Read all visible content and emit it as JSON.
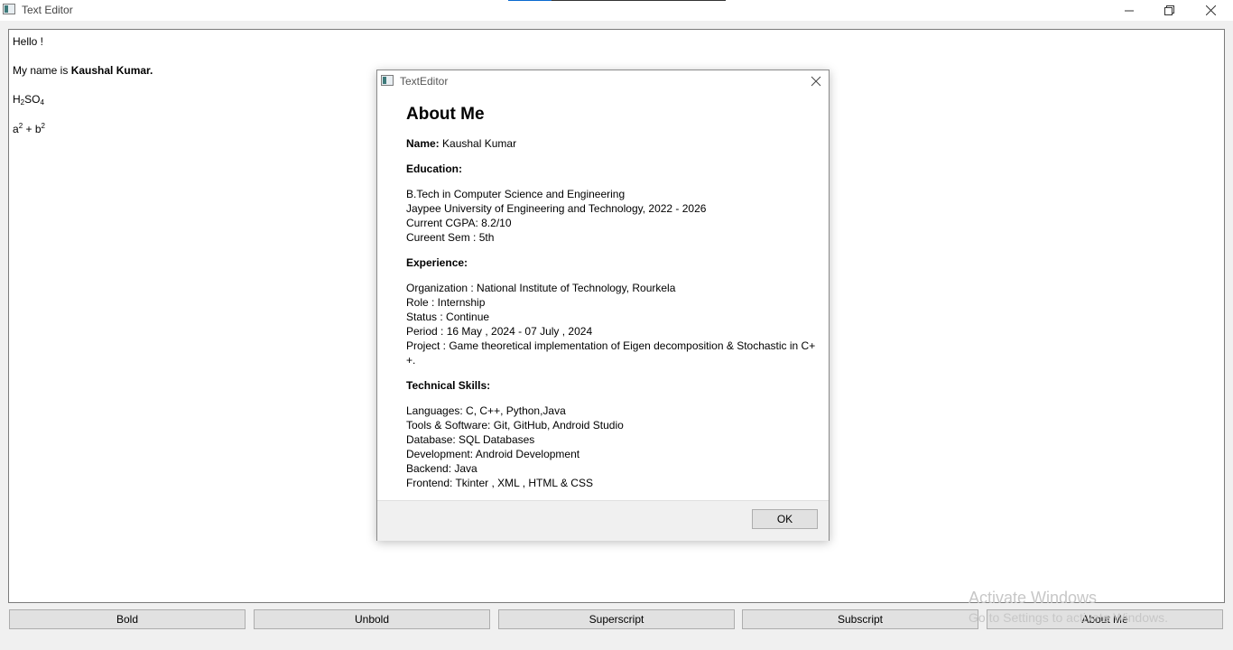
{
  "window": {
    "title": "Text Editor"
  },
  "editor": {
    "line1": "Hello !",
    "line2_prefix": "My name is ",
    "line2_bold": "Kaushal Kumar.",
    "formula1": {
      "a": "H",
      "s1": "2",
      "b": "SO",
      "s2": "4"
    },
    "formula2": {
      "a": "a",
      "p1": "2",
      "mid": " + b",
      "p2": "2"
    }
  },
  "buttons": {
    "bold": "Bold",
    "unbold": "Unbold",
    "superscript": "Superscript",
    "subscript": "Subscript",
    "about": "About Me"
  },
  "watermark": {
    "line1": "Activate Windows",
    "line2": "Go to Settings to activate Windows."
  },
  "dialog": {
    "title": "TextEditor",
    "heading": "About Me",
    "name_label": "Name:",
    "name_value": " Kaushal Kumar",
    "education_label": "Education:",
    "education": [
      "B.Tech in Computer Science and Engineering",
      "Jaypee University of Engineering and Technology, 2022 - 2026",
      "Current CGPA: 8.2/10",
      "Cureent Sem : 5th"
    ],
    "experience_label": "Experience:",
    "experience": [
      "Organization : National Institute of Technology, Rourkela",
      "Role : Internship",
      "Status : Continue",
      "Period : 16 May , 2024 - 07 July , 2024",
      "Project : Game theoretical implementation of Eigen decomposition & Stochastic in C+",
      "+."
    ],
    "skills_label": "Technical Skills:",
    "skills": [
      "Languages: C, C++, Python,Java",
      "Tools & Software: Git, GitHub, Android Studio",
      "Database: SQL Databases",
      "Development: Android Development",
      "Backend: Java",
      "Frontend: Tkinter , XML , HTML & CSS"
    ],
    "ok_label": "OK"
  }
}
